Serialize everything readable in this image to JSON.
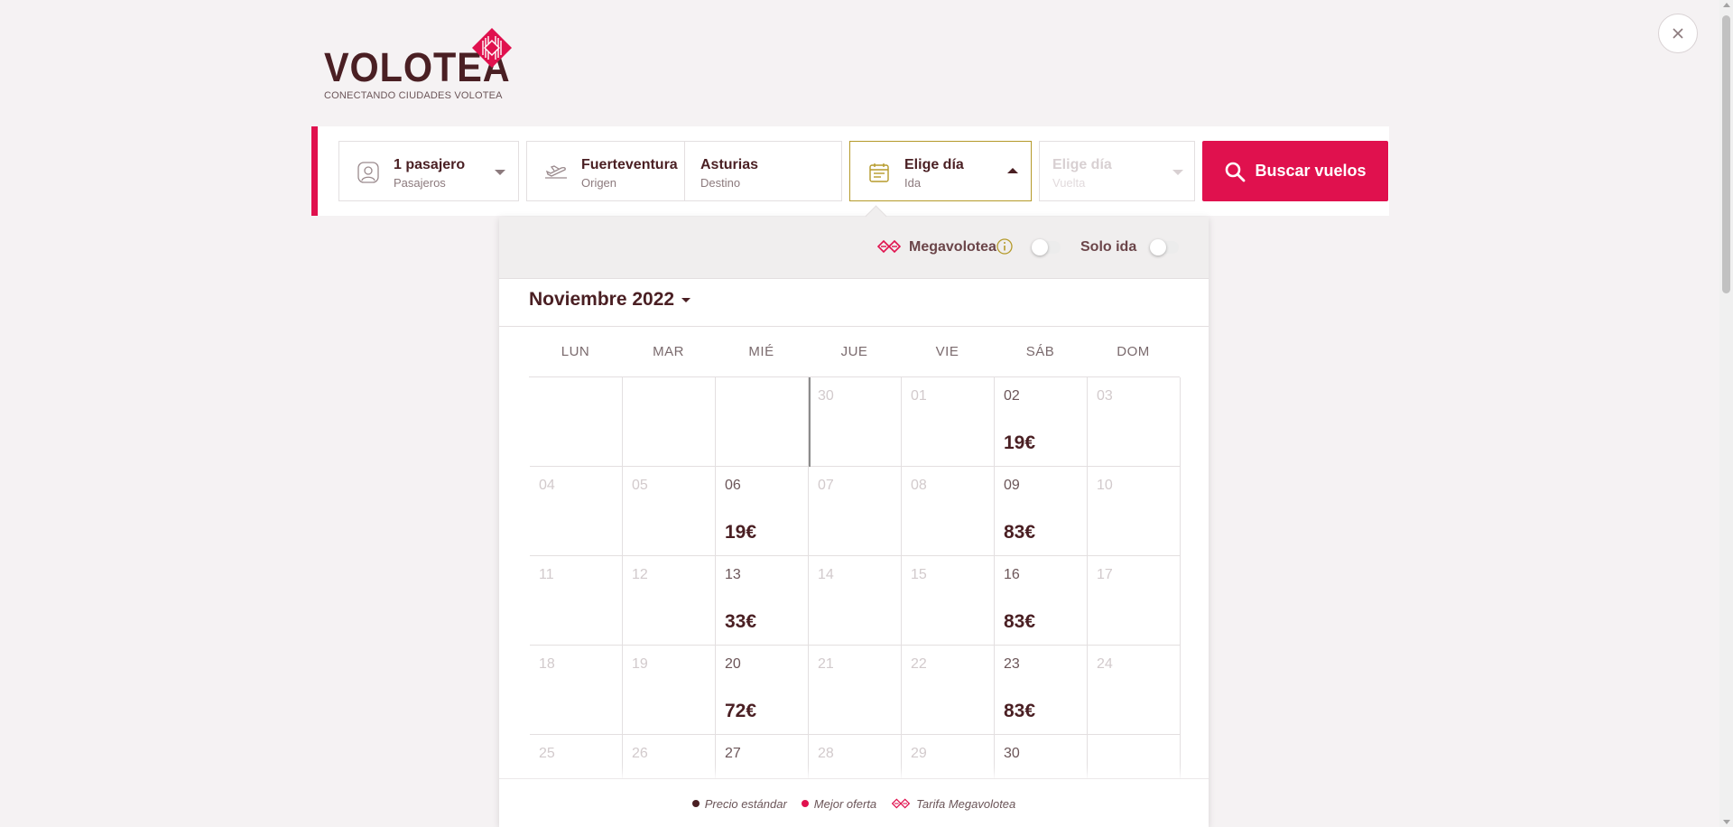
{
  "brand": {
    "name": "VOLOTEA",
    "tagline": "CONECTANDO CIUDADES VOLOTEA",
    "accent": "#e0114e",
    "dark": "#4a1f23"
  },
  "search": {
    "passengers": {
      "value": "1 pasajero",
      "label": "Pasajeros"
    },
    "origin": {
      "value": "Fuerteventura",
      "label": "Origen"
    },
    "destination": {
      "value": "Asturias",
      "label": "Destino"
    },
    "outbound": {
      "value": "Elige día",
      "label": "Ida"
    },
    "return": {
      "value": "Elige día",
      "label": "Vuelta"
    },
    "button": "Buscar vuelos"
  },
  "options": {
    "megavolotea": "Megavolotea",
    "solo_ida": "Solo ida"
  },
  "calendar": {
    "month": "Noviembre 2022",
    "weekdays": [
      "LUN",
      "MAR",
      "MIÉ",
      "JUE",
      "VIE",
      "SÁB",
      "DOM"
    ],
    "rows": [
      [
        {
          "day": ""
        },
        {
          "day": ""
        },
        {
          "day": ""
        },
        {
          "day": "30",
          "today": true
        },
        {
          "day": "01"
        },
        {
          "day": "02",
          "price": "19€"
        },
        {
          "day": "03"
        }
      ],
      [
        {
          "day": "04"
        },
        {
          "day": "05"
        },
        {
          "day": "06",
          "price": "19€"
        },
        {
          "day": "07"
        },
        {
          "day": "08"
        },
        {
          "day": "09",
          "price": "83€"
        },
        {
          "day": "10"
        }
      ],
      [
        {
          "day": "11"
        },
        {
          "day": "12"
        },
        {
          "day": "13",
          "price": "33€"
        },
        {
          "day": "14"
        },
        {
          "day": "15"
        },
        {
          "day": "16",
          "price": "83€"
        },
        {
          "day": "17"
        }
      ],
      [
        {
          "day": "18"
        },
        {
          "day": "19"
        },
        {
          "day": "20",
          "price": "72€"
        },
        {
          "day": "21"
        },
        {
          "day": "22"
        },
        {
          "day": "23",
          "price": "83€"
        },
        {
          "day": "24"
        }
      ],
      [
        {
          "day": "25"
        },
        {
          "day": "26"
        },
        {
          "day": "27",
          "avail": true
        },
        {
          "day": "28"
        },
        {
          "day": "29"
        },
        {
          "day": "30",
          "avail": true
        },
        {
          "day": ""
        }
      ]
    ]
  },
  "legend": {
    "standard": {
      "label": "Precio estándar",
      "color": "#4a1f23"
    },
    "best": {
      "label": "Mejor oferta",
      "color": "#e0114e"
    },
    "mega": {
      "label": "Tarifa Megavolotea",
      "color": "#e0114e"
    }
  }
}
